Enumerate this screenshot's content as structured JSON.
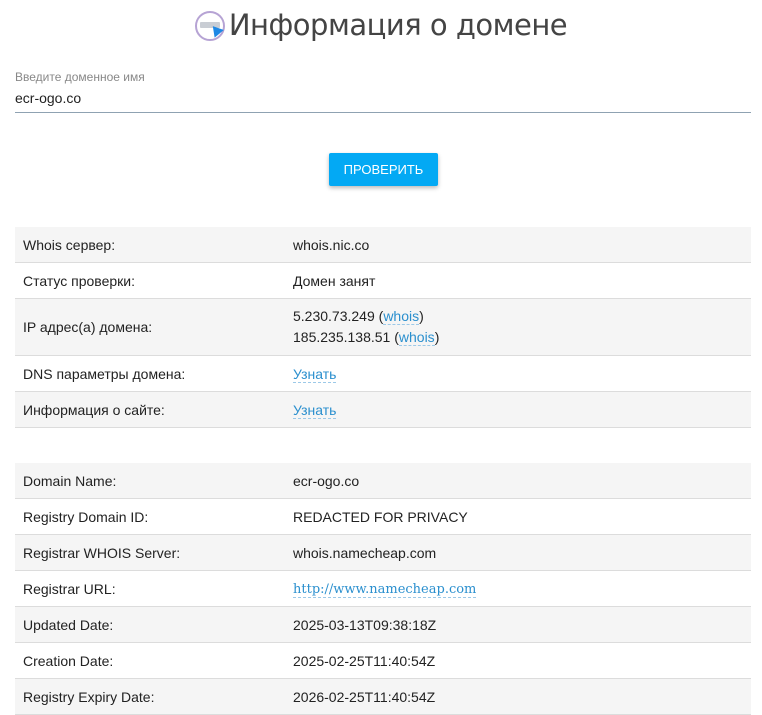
{
  "header": {
    "title": "Информация о домене",
    "logo_icon": "domain-search-icon"
  },
  "search": {
    "label": "Введите доменное имя",
    "value": "ecr-ogo.co"
  },
  "check_button": {
    "label": "ПРОВЕРИТЬ"
  },
  "summary": {
    "whois_server": {
      "label": "Whois сервер:",
      "value": "whois.nic.co"
    },
    "status": {
      "label": "Статус проверки:",
      "value": "Домен занят"
    },
    "ip": {
      "label": "IP адрес(а) домена:",
      "addresses": [
        {
          "ip": "5.230.73.249",
          "link": "whois"
        },
        {
          "ip": "185.235.138.51",
          "link": "whois"
        }
      ]
    },
    "dns": {
      "label": "DNS параметры домена:",
      "link": "Узнать"
    },
    "site_info": {
      "label": "Информация о сайте:",
      "link": "Узнать"
    }
  },
  "whois": [
    {
      "label": "Domain Name:",
      "value": "ecr-ogo.co"
    },
    {
      "label": "Registry Domain ID:",
      "value": "REDACTED FOR PRIVACY"
    },
    {
      "label": "Registrar WHOIS Server:",
      "value": "whois.namecheap.com"
    },
    {
      "label": "Registrar URL:",
      "value": "http://www.namecheap.com"
    },
    {
      "label": "Updated Date:",
      "value": "2025-03-13T09:38:18Z"
    },
    {
      "label": "Creation Date:",
      "value": "2025-02-25T11:40:54Z"
    },
    {
      "label": "Registry Expiry Date:",
      "value": "2026-02-25T11:40:54Z"
    }
  ],
  "colors": {
    "accent": "#03a9f4",
    "link": "#2a8fce",
    "row_alt": "#f5f5f5"
  }
}
